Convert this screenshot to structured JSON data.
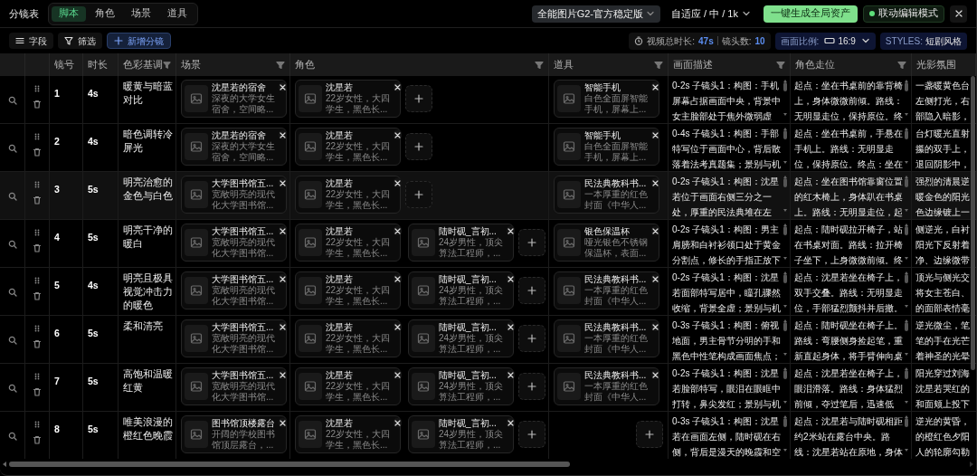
{
  "header": {
    "title": "分镜表",
    "tabs": [
      {
        "label": "脚本",
        "selected": true
      },
      {
        "label": "角色",
        "selected": false
      },
      {
        "label": "场景",
        "selected": false
      },
      {
        "label": "道具",
        "selected": false
      }
    ],
    "model": "全能图片G2-官方稳定版",
    "quality": "自适应 / 中 / 1k",
    "generate_button": "一键生成全局资产",
    "linked_edit": {
      "label": "联动编辑模式",
      "on": true
    }
  },
  "toolbar": {
    "buttons": [
      {
        "kind": "fields",
        "label": "字段"
      },
      {
        "kind": "filter",
        "label": "筛选"
      },
      {
        "kind": "add",
        "label": "新增分镜"
      }
    ],
    "duration_label": "视频总时长:",
    "duration": "47s",
    "shots_label": "镜头数:",
    "shots": "10",
    "ratio_label": "画面比例:",
    "ratio": "16:9",
    "styles_label": "STYLES:",
    "styles": "短剧风格"
  },
  "table": {
    "columns": [
      {
        "label": "镜号",
        "filter": false
      },
      {
        "label": "时长",
        "filter": false
      },
      {
        "label": "色彩基调",
        "filter": true
      },
      {
        "label": "场景",
        "filter": true
      },
      {
        "label": "角色",
        "filter": true
      },
      {
        "label": "道具",
        "filter": true
      },
      {
        "label": "画面描述",
        "filter": true
      },
      {
        "label": "角色走位",
        "filter": true
      },
      {
        "label": "光影氛围",
        "filter": false
      }
    ],
    "rows": [
      {
        "number": "1",
        "duration": "4s",
        "tone": "暖黄与暗蓝对比",
        "highlighted": false,
        "scenes": [
          {
            "name": "沈星若的宿舍",
            "desc": [
              "深夜的大学女生",
              "宿舍，空间略..."
            ]
          }
        ],
        "roles": [
          {
            "name": "沈星若",
            "desc": [
              "22岁女性，大四",
              "学生，黑色长..."
            ]
          }
        ],
        "role_add": true,
        "props": [
          {
            "name": "智能手机",
            "desc": [
              "白色全面屏智能",
              "手机，屏幕上..."
            ]
          }
        ],
        "prop_add": false,
        "description": [
          "0-2s 子镜头1：构图：手机",
          "屏幕占据画面中央，背景中",
          "女主脸部处于焦外微弱虚"
        ],
        "blocking": [
          "起点：坐在书桌前的靠背椅",
          "上，身体微微前倾。路线：",
          "无明显走位，保持原位。终"
        ],
        "lighting": [
          "一盏暖黄色台",
          "左侧打光，右",
          "部隐入暗影，"
        ]
      },
      {
        "number": "2",
        "duration": "4s",
        "tone": "暗色调转冷屏光",
        "highlighted": false,
        "scenes": [
          {
            "name": "沈星若的宿舍",
            "desc": [
              "深夜的大学女生",
              "宿舍，空间略..."
            ]
          }
        ],
        "roles": [
          {
            "name": "沈星若",
            "desc": [
              "22岁女性，大四",
              "学生，黑色长..."
            ]
          }
        ],
        "role_add": true,
        "props": [
          {
            "name": "智能手机",
            "desc": [
              "白色全面屏智能",
              "手机，屏幕上..."
            ]
          }
        ],
        "prop_add": false,
        "description": [
          "0-4s 子镜头1：构图：手部",
          "特写位于画面中心，背后散",
          "落着法考真题集；景别与机"
        ],
        "blocking": [
          "起点：坐在书桌前，手悬在",
          "手机上。路线：无明显走",
          "位，保持原位。终点：坐在"
        ],
        "lighting": [
          "台灯暖光直射",
          "攥的双手上，",
          "退回阴影中，"
        ]
      },
      {
        "number": "3",
        "duration": "5s",
        "tone": "明亮治愈的金色与白色",
        "highlighted": true,
        "scenes": [
          {
            "name": "大学图书馆五...",
            "desc": [
              "宽敞明亮的现代",
              "化大学图书馆..."
            ]
          }
        ],
        "roles": [
          {
            "name": "沈星若",
            "desc": [
              "22岁女性，大四",
              "学生，黑色长..."
            ]
          }
        ],
        "role_add": true,
        "props": [
          {
            "name": "民法典教科书...",
            "desc": [
              "一本厚重的红色",
              "封面《中华人..."
            ]
          }
        ],
        "prop_add": false,
        "description": [
          "0-2s 子镜头1：构图：沈星",
          "若位于画面右侧三分之一",
          "处，厚重的民法典堆在左"
        ],
        "blocking": [
          "起点：坐在图书馆靠窗位置",
          "的红木椅上，身体趴在书桌",
          "上。路线：无明显走位，起"
        ],
        "lighting": [
          "强烈的清晨逆",
          "暖金色的阳光",
          "色边缘镀上一"
        ]
      },
      {
        "number": "4",
        "duration": "5s",
        "tone": "明亮干净的暖白",
        "highlighted": false,
        "scenes": [
          {
            "name": "大学图书馆五...",
            "desc": [
              "宽敞明亮的现代",
              "化大学图书馆..."
            ]
          }
        ],
        "roles": [
          {
            "name": "沈星若",
            "desc": [
              "22岁女性，大四",
              "学生，黑色长..."
            ]
          },
          {
            "name": "陆时砚_言初...",
            "desc": [
              "24岁男性，顶尖",
              "算法工程师，..."
            ]
          }
        ],
        "role_add": true,
        "props": [
          {
            "name": "银色保温杯",
            "desc": [
              "哑光银色不锈钢",
              "保温杯，表面..."
            ]
          }
        ],
        "prop_add": false,
        "description": [
          "0-2s 子镜头1：构图：男主",
          "肩膀和白衬衫领口处于黄金",
          "分割点，修长的手指正放下"
        ],
        "blocking": [
          "起点：陆时砚拉开椅子，站",
          "在书桌对面。路线：拉开椅",
          "子坐下，上身微微前倾。终"
        ],
        "lighting": [
          "侧逆光，白衬",
          "阳光下反射着",
          "净、边缘微带"
        ]
      },
      {
        "number": "5",
        "duration": "4s",
        "tone": "明亮且极具视觉冲击力的暖色",
        "highlighted": false,
        "scenes": [
          {
            "name": "大学图书馆五...",
            "desc": [
              "宽敞明亮的现代",
              "化大学图书馆..."
            ]
          }
        ],
        "roles": [
          {
            "name": "沈星若",
            "desc": [
              "22岁女性，大四",
              "学生，黑色长..."
            ]
          },
          {
            "name": "陆时砚_言初...",
            "desc": [
              "24岁男性，顶尖",
              "算法工程师，..."
            ]
          }
        ],
        "role_add": true,
        "props": [
          {
            "name": "民法典教科书...",
            "desc": [
              "一本厚重的红色",
              "封面《中华人..."
            ]
          }
        ],
        "prop_add": false,
        "description": [
          "0-2s 子镜头1：构图：沈星",
          "若面部特写居中，瞳孔骤然",
          "收缩，背景全虚；景别与机"
        ],
        "blocking": [
          "起点：沈星若坐在椅子上，",
          "双手交叠。路线：无明显走",
          "位，手部猛烈颤抖并后撤。"
        ],
        "lighting": [
          "顶光与侧光交",
          "将女主苍白、",
          "的面部表情毫"
        ]
      },
      {
        "number": "6",
        "duration": "5s",
        "tone": "柔和清亮",
        "highlighted": false,
        "scenes": [
          {
            "name": "大学图书馆五...",
            "desc": [
              "宽敞明亮的现代",
              "化大学图书馆..."
            ]
          }
        ],
        "roles": [
          {
            "name": "沈星若",
            "desc": [
              "22岁女性，大四",
              "学生，黑色长..."
            ]
          },
          {
            "name": "陆时砚_言初...",
            "desc": [
              "24岁男性，顶尖",
              "算法工程师，..."
            ]
          }
        ],
        "role_add": true,
        "props": [
          {
            "name": "民法典教科书...",
            "desc": [
              "一本厚重的红色",
              "封面《中华人..."
            ]
          }
        ],
        "prop_add": false,
        "description": [
          "0-3s 子镜头1：构图：俯视",
          "地面，男主骨节分明的手和",
          "黑色中性笔构成画面焦点；"
        ],
        "blocking": [
          "起点：陆时砚坐在椅子上。",
          "路线：弯腰侧身捡起笔，重",
          "新直起身体，将手臂伸向桌"
        ],
        "lighting": [
          "逆光微尘，笔",
          "笔的手在光芒",
          "着神圣的光晕"
        ]
      },
      {
        "number": "7",
        "duration": "5s",
        "tone": "高饱和温暖红黄",
        "highlighted": false,
        "scenes": [
          {
            "name": "大学图书馆五...",
            "desc": [
              "宽敞明亮的现代",
              "化大学图书馆..."
            ]
          }
        ],
        "roles": [
          {
            "name": "沈星若",
            "desc": [
              "22岁女性，大四",
              "学生，黑色长..."
            ]
          },
          {
            "name": "陆时砚_言初...",
            "desc": [
              "24岁男性，顶尖",
              "算法工程师，..."
            ]
          }
        ],
        "role_add": true,
        "props": [
          {
            "name": "民法典教科书...",
            "desc": [
              "一本厚重的红色",
              "封面《中华人..."
            ]
          }
        ],
        "prop_add": false,
        "description": [
          "0-2s 子镜头1：构图：沈星",
          "若脸部特写，眼泪在眼眶中",
          "打转，鼻尖发红；景别与机"
        ],
        "blocking": [
          "起点：沈星若坐在椅子上，",
          "眼泪滑落。路线：身体猛烈",
          "前倾，夺过笔后，迅速低"
        ],
        "lighting": [
          "阳光穿过刘海",
          "沈星若哭红的",
          "和面颊上投下"
        ]
      },
      {
        "number": "8",
        "duration": "5s",
        "tone": "唯美浪漫的橙红色晚霞",
        "highlighted": false,
        "scenes": [
          {
            "name": "图书馆顶楼露台",
            "desc": [
              "开阔的学校图书",
              "馆顶层露台，..."
            ]
          }
        ],
        "roles": [
          {
            "name": "沈星若",
            "desc": [
              "22岁女性，大四",
              "学生，黑色长..."
            ]
          },
          {
            "name": "陆时砚_言初...",
            "desc": [
              "24岁男性，顶尖",
              "算法工程师，..."
            ]
          }
        ],
        "role_add": true,
        "props": [],
        "prop_add": true,
        "description": [
          "0-3s 子镜头1：构图：沈星",
          "若在画面左侧，陆时砚在右",
          "侧，背后是漫天的晚霞和空"
        ],
        "blocking": [
          "起点：沈星若与陆时砚相距",
          "约2米站在露台中央。路",
          "线：沈星若站在原地，身体"
        ],
        "lighting": [
          "逆光的黄昏，",
          "的橙红色夕阳",
          "人的轮廓勾勒"
        ]
      }
    ]
  }
}
